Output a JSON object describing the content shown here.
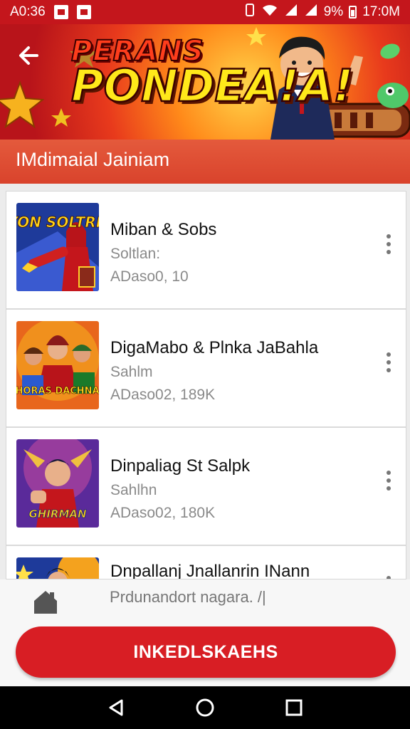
{
  "status_bar": {
    "time_left": "A0:36",
    "battery_percent": "9%",
    "time_right": "17:0M"
  },
  "banner": {
    "title_line1": "PERANS",
    "title_line2": "PONDEA!A!"
  },
  "section": {
    "title": "IMdimaial Jainiam"
  },
  "list": {
    "items": [
      {
        "title": "Miban & Sobs",
        "subtitle": "Soltlan:",
        "meta": "ADaso0, 10",
        "thumb_text": "IYON SOLTRIN"
      },
      {
        "title": "DigaMabo & Plnka JaBahla",
        "subtitle": "Sahlm",
        "meta": "ADaso02, 189K",
        "thumb_text": "RHORAS DACHNAN"
      },
      {
        "title": "Dinpaliag St Salpk",
        "subtitle": "Sahlhn",
        "meta": "ADaso02, 180K",
        "thumb_text": "GHIRMAN"
      },
      {
        "title": "Dnpallanj Jnallanrin INann",
        "subtitle": "",
        "meta": ""
      }
    ]
  },
  "bottom": {
    "caption": "Prdunandort nagara. /|",
    "primary_button": "INKEDLSKAEHS"
  },
  "colors": {
    "accent": "#c4161c",
    "header": "#d9432c",
    "button": "#d81e24"
  },
  "icons": [
    "back-arrow-icon",
    "home-icon",
    "more-vert-icon",
    "nav-back-icon",
    "nav-home-icon",
    "nav-recents-icon",
    "wifi-icon",
    "signal-icon",
    "battery-icon"
  ]
}
